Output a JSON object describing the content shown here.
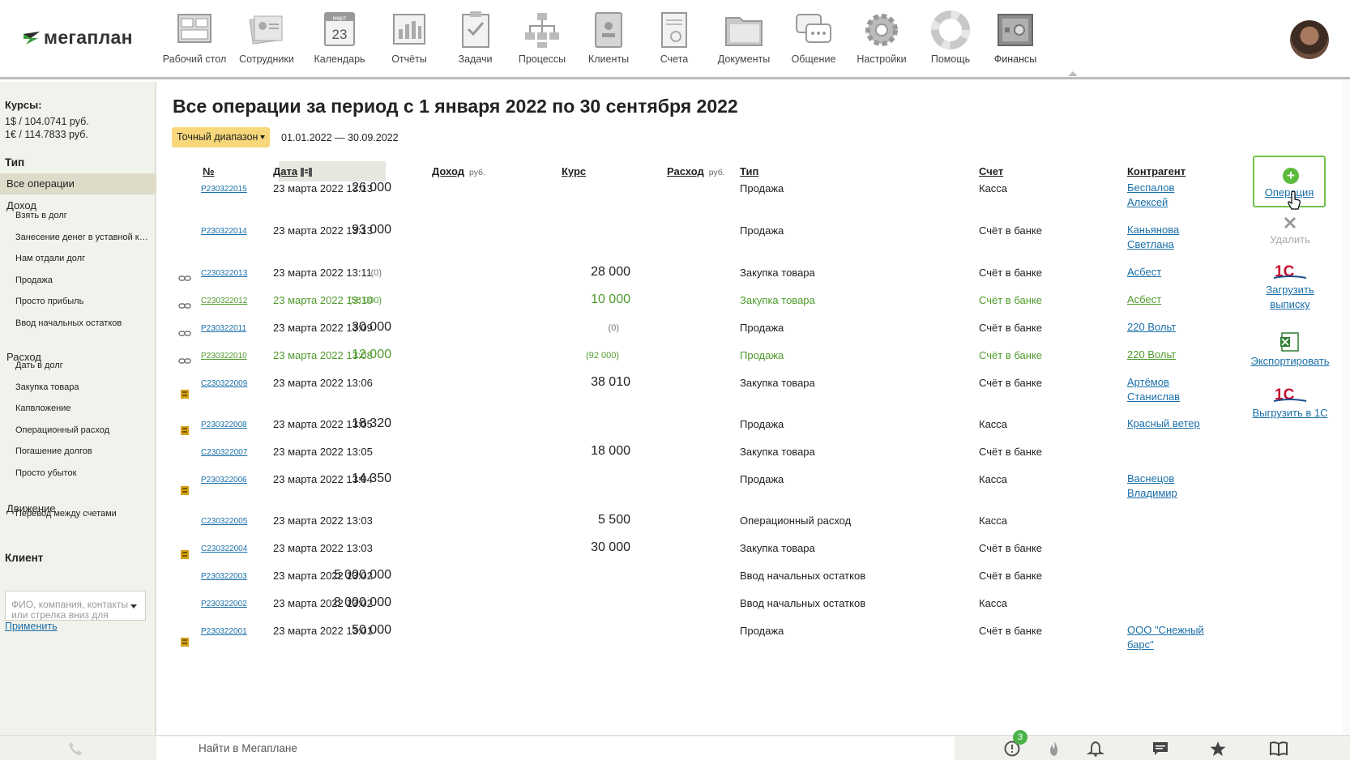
{
  "app": {
    "logo_text": "мегаплан"
  },
  "nav": [
    {
      "label": "Рабочий стол",
      "icon": "desktop-icon"
    },
    {
      "label": "Сотрудники",
      "icon": "employees-icon"
    },
    {
      "label": "Календарь",
      "icon": "calendar-icon",
      "cal_month": "март",
      "cal_day": "23"
    },
    {
      "label": "Отчёты",
      "icon": "reports-icon"
    },
    {
      "label": "Задачи",
      "icon": "tasks-icon"
    },
    {
      "label": "Процессы",
      "icon": "processes-icon"
    },
    {
      "label": "Клиенты",
      "icon": "clients-icon"
    },
    {
      "label": "Счета",
      "icon": "invoices-icon"
    },
    {
      "label": "Документы",
      "icon": "documents-icon"
    },
    {
      "label": "Общение",
      "icon": "chat-icon"
    },
    {
      "label": "Настройки",
      "icon": "gear-icon"
    },
    {
      "label": "Помощь",
      "icon": "lifebuoy-icon"
    },
    {
      "label": "Финансы",
      "icon": "safe-icon"
    }
  ],
  "sidebar": {
    "rates_title": "Курсы:",
    "rate_usd": "1$ / 104.0741 руб.",
    "rate_eur": "1€ / 114.7833 руб.",
    "type_title": "Тип",
    "all_ops": "Все операции",
    "income": "Доход",
    "income_items": [
      "Взять в долг",
      "Занесение денег в уставной капитал",
      "Нам отдали долг",
      "Продажа",
      "Просто прибыль",
      "Ввод начальных остатков"
    ],
    "expense": "Расход",
    "expense_items": [
      "Дать в долг",
      "Закупка товара",
      "Капвложение",
      "Операционный расход",
      "Погашение долгов",
      "Просто убыток"
    ],
    "movement": "Движение",
    "movement_items": [
      "Перевод между счетами"
    ],
    "client_title": "Клиент",
    "client_placeholder": "ФИО, компания, контакты или стрелка вниз для",
    "apply": "Применить"
  },
  "main": {
    "title": "Все операции за период с 1 января 2022 по 30 сентября 2022",
    "range_button": "Точный диапазон",
    "range_text": "01.01.2022 — 30.09.2022",
    "headers": {
      "num": "№",
      "date": "Дата",
      "income": "Доход",
      "income_unit": "руб.",
      "rate": "Курс",
      "expense": "Расход",
      "expense_unit": "руб.",
      "type": "Тип",
      "account": "Счет",
      "counterparty": "Контрагент"
    }
  },
  "rows": [
    {
      "num": "P230322015",
      "date": "23 марта 2022 13:13",
      "income": "26 000",
      "expense": "",
      "type": "Продажа",
      "account": "Касса",
      "cp": "Беспалов Алексей",
      "icon": "",
      "green": false
    },
    {
      "num": "P230322014",
      "date": "23 марта 2022 13:13",
      "income": "93 000",
      "expense": "",
      "type": "Продажа",
      "account": "Счёт в банке",
      "cp": "Каньянова Светлана",
      "icon": "",
      "green": false
    },
    {
      "num": "C230322013",
      "date": "23 марта 2022 13:11",
      "income_paren": "(0)",
      "expense": "28 000",
      "type": "Закупка товара",
      "account": "Счёт в банке",
      "cp": "Асбест",
      "icon": "link-icon",
      "green": false
    },
    {
      "num": "C230322012",
      "date": "23 марта 2022 13:10",
      "income_paren": "(58 000)",
      "expense": "10 000",
      "type": "Закупка товара",
      "account": "Счёт в банке",
      "cp": "Асбест",
      "icon": "link-icon",
      "green": true
    },
    {
      "num": "P230322011",
      "date": "23 марта 2022 13:09",
      "income": "30 000",
      "expense_paren": "(0)",
      "type": "Продажа",
      "account": "Счёт в банке",
      "cp": "220 Вольт",
      "icon": "link-icon",
      "green": false
    },
    {
      "num": "P230322010",
      "date": "23 марта 2022 13:08",
      "income": "12 000",
      "expense_paren": "(92 000)",
      "type": "Продажа",
      "account": "Счёт в банке",
      "cp": "220 Вольт",
      "icon": "link-icon",
      "green": true
    },
    {
      "num": "C230322009",
      "date": "23 марта 2022 13:06",
      "income": "",
      "expense": "38 010",
      "type": "Закупка товара",
      "account": "Счёт в банке",
      "cp": "Артёмов Станислав",
      "icon": "coins-icon",
      "green": false
    },
    {
      "num": "P230322008",
      "date": "23 марта 2022 13:05",
      "income": "18 320",
      "expense": "",
      "type": "Продажа",
      "account": "Касса",
      "cp": "Красный ветер",
      "icon": "coins-icon",
      "green": false
    },
    {
      "num": "C230322007",
      "date": "23 марта 2022 13:05",
      "income": "",
      "expense": "18 000",
      "type": "Закупка товара",
      "account": "Счёт в банке",
      "cp": "",
      "icon": "",
      "green": false
    },
    {
      "num": "P230322006",
      "date": "23 марта 2022 13:04",
      "income": "14 350",
      "expense": "",
      "type": "Продажа",
      "account": "Касса",
      "cp": "Васнецов Владимир",
      "icon": "coins-icon",
      "green": false
    },
    {
      "num": "C230322005",
      "date": "23 марта 2022 13:03",
      "income": "",
      "expense": "5 500",
      "type": "Операционный расход",
      "account": "Касса",
      "cp": "",
      "icon": "",
      "green": false
    },
    {
      "num": "C230322004",
      "date": "23 марта 2022 13:03",
      "income": "",
      "expense": "30 000",
      "type": "Закупка товара",
      "account": "Счёт в банке",
      "cp": "",
      "icon": "coins-icon",
      "green": false
    },
    {
      "num": "P230322003",
      "date": "23 марта 2022 13:02",
      "income": "5 000 000",
      "expense": "",
      "type": "Ввод начальных остатков",
      "account": "Счёт в банке",
      "cp": "",
      "icon": "",
      "green": false
    },
    {
      "num": "P230322002",
      "date": "23 марта 2022 13:02",
      "income": "8 000 000",
      "expense": "",
      "type": "Ввод начальных остатков",
      "account": "Касса",
      "cp": "",
      "icon": "",
      "green": false
    },
    {
      "num": "P230322001",
      "date": "23 марта 2022 13:01",
      "income": "50 000",
      "expense": "",
      "type": "Продажа",
      "account": "Счёт в банке",
      "cp": "ООО \"Снежный барс\"",
      "icon": "coins-icon",
      "green": false
    }
  ],
  "actions": {
    "operation": "Операция",
    "delete": "Удалить",
    "import_statement": "Загрузить выписку",
    "export": "Экспортировать",
    "export_1c": "Выгрузить в 1С",
    "onec_label": "1С"
  },
  "footer": {
    "search": "Найти в Мегаплане",
    "alert_count": "3"
  },
  "colors": {
    "accent_green": "#5cbb3b",
    "link": "#1a6fa8",
    "highlight": "#f7d77a",
    "green_row": "#4f9a2c"
  }
}
